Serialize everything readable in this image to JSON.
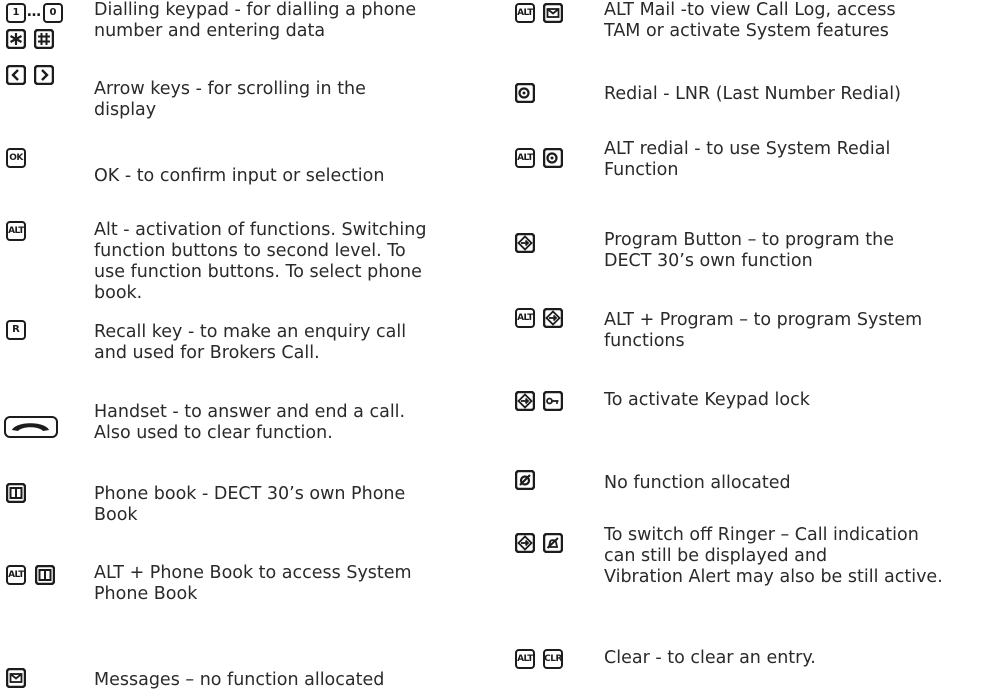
{
  "left_column": [
    {
      "id": "dial",
      "keys": [
        "1",
        "…",
        "0",
        "*",
        "#"
      ],
      "icon_names": [
        "key-1-icon",
        "ellipsis",
        "key-0-icon",
        "star-key-icon",
        "hash-key-icon"
      ],
      "text": "Dialling keypad - for dialling a phone\nnumber and entering data"
    },
    {
      "id": "arrows",
      "keys": [
        "<",
        ">"
      ],
      "icon_names": [
        "arrow-left-key-icon",
        "arrow-right-key-icon"
      ],
      "text": "Arrow keys - for scrolling in the\ndisplay"
    },
    {
      "id": "ok",
      "keys": [
        "OK"
      ],
      "icon_names": [
        "ok-key-icon"
      ],
      "text": "OK - to confirm input or selection"
    },
    {
      "id": "alt",
      "keys": [
        "ALT"
      ],
      "icon_names": [
        "alt-key-icon"
      ],
      "text": "Alt - activation of functions. Switching\nfunction buttons to second level. To\nuse function buttons. To select phone\nbook."
    },
    {
      "id": "recall",
      "keys": [
        "R"
      ],
      "icon_names": [
        "recall-key-icon"
      ],
      "text": "Recall key - to make an enquiry call\nand used for Brokers Call."
    },
    {
      "id": "handset",
      "keys": [],
      "icon_names": [
        "handset-key-icon"
      ],
      "text": "Handset - to answer and end a call.\nAlso used to clear function."
    },
    {
      "id": "phonebook",
      "keys": [],
      "icon_names": [
        "phone-book-key-icon"
      ],
      "text": "Phone book - DECT 30’s own Phone\nBook"
    },
    {
      "id": "alt-phonebook",
      "keys": [
        "ALT"
      ],
      "icon_names": [
        "alt-key-icon",
        "phone-book-key-icon"
      ],
      "text": "ALT + Phone Book to access System\nPhone Book"
    },
    {
      "id": "messages",
      "keys": [],
      "icon_names": [
        "envelope-key-icon"
      ],
      "text": "Messages – no function allocated"
    }
  ],
  "right_column": [
    {
      "id": "alt-mail",
      "keys": [
        "ALT"
      ],
      "icon_names": [
        "alt-key-icon",
        "envelope-key-icon"
      ],
      "text": "ALT Mail -to view Call Log, access\nTAM or activate System features"
    },
    {
      "id": "redial",
      "keys": [],
      "icon_names": [
        "redial-key-icon"
      ],
      "text": "Redial - LNR (Last Number Redial)"
    },
    {
      "id": "alt-redial",
      "keys": [
        "ALT"
      ],
      "icon_names": [
        "alt-key-icon",
        "redial-key-icon"
      ],
      "text": "ALT redial - to use System Redial\nFunction"
    },
    {
      "id": "program",
      "keys": [],
      "icon_names": [
        "program-key-icon"
      ],
      "text": "Program Button – to program the\nDECT 30’s own function"
    },
    {
      "id": "alt-program",
      "keys": [
        "ALT"
      ],
      "icon_names": [
        "alt-key-icon",
        "program-key-icon"
      ],
      "text": "ALT + Program – to program System\nfunctions"
    },
    {
      "id": "keylock",
      "keys": [],
      "icon_names": [
        "program-key-icon",
        "key-lock-icon"
      ],
      "text": "To activate Keypad lock"
    },
    {
      "id": "nofunc",
      "keys": [],
      "icon_names": [
        "no-function-key-icon"
      ],
      "text": "No function allocated"
    },
    {
      "id": "ringer",
      "keys": [],
      "icon_names": [
        "program-key-icon",
        "ringer-off-key-icon"
      ],
      "text": "To switch off Ringer – Call indication\ncan still be displayed and\nVibration Alert may also be still active."
    },
    {
      "id": "clear",
      "keys": [
        "ALT",
        "CLR"
      ],
      "icon_names": [
        "alt-key-icon",
        "clear-key-icon"
      ],
      "text": "Clear - to clear an entry."
    }
  ]
}
